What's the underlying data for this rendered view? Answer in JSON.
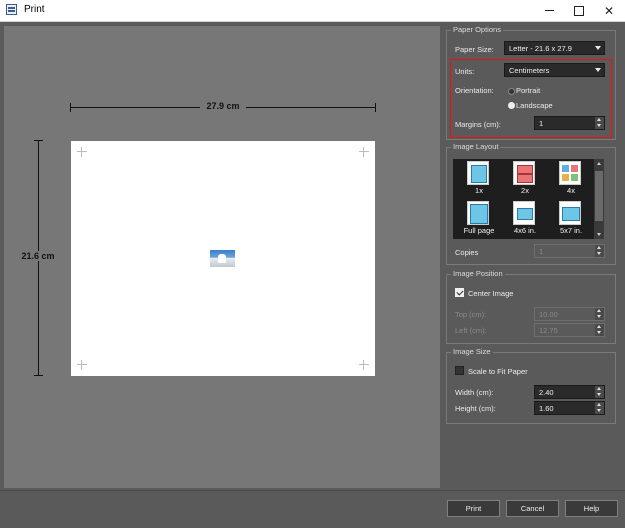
{
  "window": {
    "title": "Print"
  },
  "preview": {
    "width_label": "27.9 cm",
    "height_label": "21.6 cm"
  },
  "paper_options": {
    "title": "Paper Options",
    "paper_size_label": "Paper Size:",
    "paper_size_value": "Letter - 21.6 x 27.9",
    "units_label": "Units:",
    "units_value": "Centimeters",
    "orientation_label": "Orientation:",
    "portrait_label": "Portrait",
    "landscape_label": "Landscape",
    "orientation_selected": "Landscape",
    "margins_label": "Margins (cm):",
    "margins_value": "1"
  },
  "image_layout": {
    "title": "Image Layout",
    "items": [
      {
        "label": "1x",
        "icon": "single-photo-icon"
      },
      {
        "label": "2x",
        "icon": "two-photos-icon"
      },
      {
        "label": "4x",
        "icon": "four-photos-icon"
      },
      {
        "label": "Full page",
        "icon": "full-page-icon"
      },
      {
        "label": "4x6 in.",
        "icon": "4x6-photo-icon"
      },
      {
        "label": "5x7 in.",
        "icon": "5x7-photo-icon"
      }
    ],
    "copies_label": "Copies",
    "copies_value": "1"
  },
  "image_position": {
    "title": "Image Position",
    "center_label": "Center Image",
    "center_checked": true,
    "top_label": "Top (cm):",
    "top_value": "10.00",
    "left_label": "Left (cm):",
    "left_value": "12.75"
  },
  "image_size": {
    "title": "Image Size",
    "scale_label": "Scale to Fit Paper",
    "scale_checked": false,
    "width_label": "Width (cm):",
    "width_value": "2.40",
    "height_label": "Height (cm):",
    "height_value": "1.60"
  },
  "buttons": {
    "print": "Print",
    "cancel": "Cancel",
    "help": "Help"
  },
  "colors": {
    "highlight": "#ee1111",
    "panel": "#5a5a5a",
    "preview_bg": "#777777"
  }
}
